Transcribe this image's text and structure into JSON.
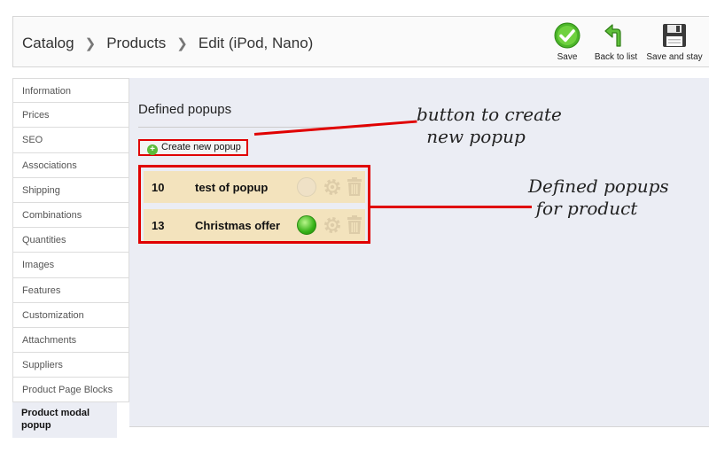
{
  "breadcrumb": [
    "Catalog",
    "Products",
    "Edit (iPod, Nano)"
  ],
  "toolbar": {
    "save_label": "Save",
    "back_label": "Back to list",
    "save_stay_label": "Save and stay"
  },
  "sidebar": {
    "items": [
      {
        "label": "Information"
      },
      {
        "label": "Prices"
      },
      {
        "label": "SEO"
      },
      {
        "label": "Associations"
      },
      {
        "label": "Shipping"
      },
      {
        "label": "Combinations"
      },
      {
        "label": "Quantities"
      },
      {
        "label": "Images"
      },
      {
        "label": "Features"
      },
      {
        "label": "Customization"
      },
      {
        "label": "Attachments"
      },
      {
        "label": "Suppliers"
      },
      {
        "label": "Product Page Blocks"
      }
    ],
    "active_label": "Product modal popup"
  },
  "content": {
    "title": "Defined popups",
    "create_label": "Create new popup",
    "popups": [
      {
        "id": "10",
        "name": "test of popup",
        "active": false
      },
      {
        "id": "13",
        "name": "Christmas offer",
        "active": true
      }
    ]
  },
  "annotations": {
    "create_note_line1": "button to create",
    "create_note_line2": "new popup",
    "list_note_line1": "Defined popups",
    "list_note_line2": "for product"
  },
  "colors": {
    "annotation_red": "#e00000",
    "row_background": "#f3e3bd",
    "active_status_green": "#37b218"
  }
}
